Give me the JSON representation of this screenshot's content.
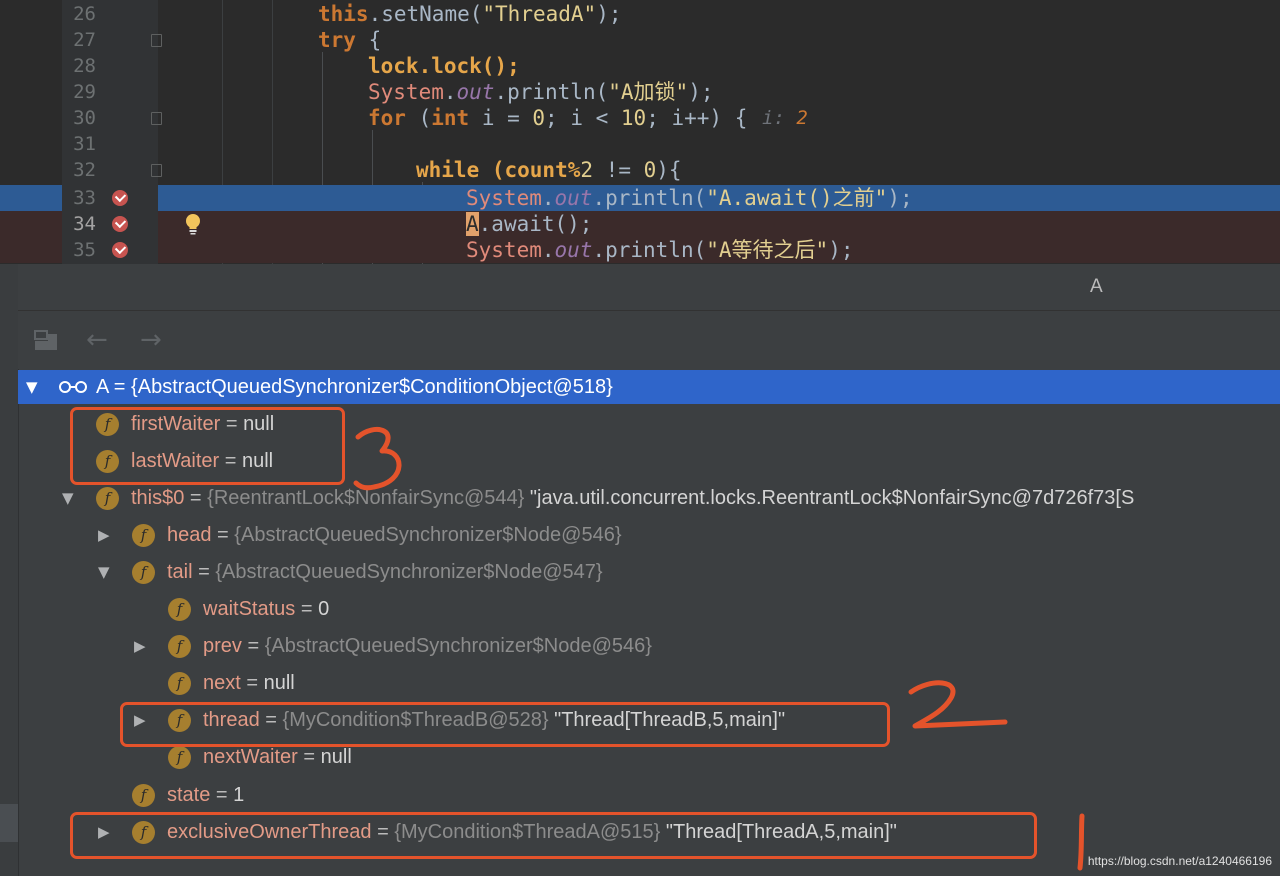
{
  "editor": {
    "lines": [
      {
        "num": "26",
        "parts": [
          [
            "kw",
            "this"
          ],
          [
            "p",
            "."
          ],
          [
            "p",
            "setName("
          ],
          [
            "str2",
            "\"ThreadA\""
          ],
          [
            "p",
            ");"
          ]
        ]
      },
      {
        "num": "27",
        "parts": [
          [
            "kw",
            "try"
          ],
          [
            "p",
            " {"
          ]
        ]
      },
      {
        "num": "28",
        "parts": [
          [
            "p",
            "lock.lock();"
          ]
        ]
      },
      {
        "num": "29",
        "parts": [
          [
            "cls",
            "System"
          ],
          [
            "p",
            "."
          ],
          [
            "fld",
            "out"
          ],
          [
            "p",
            ".println("
          ],
          [
            "str2",
            "\"A加锁\""
          ],
          [
            "p",
            ");"
          ]
        ]
      },
      {
        "num": "30",
        "parts": [
          [
            "kw",
            "for"
          ],
          [
            "p",
            " ("
          ],
          [
            "kw",
            "int"
          ],
          [
            "p",
            " i = "
          ],
          [
            "num",
            "0"
          ],
          [
            "p",
            "; i < "
          ],
          [
            "num",
            "10"
          ],
          [
            "p",
            "; i++) {"
          ]
        ]
      },
      {
        "num": "31",
        "parts": []
      },
      {
        "num": "32",
        "parts": [
          [
            "kw",
            "while"
          ],
          [
            "p",
            " (count%"
          ],
          [
            "num",
            "2"
          ],
          [
            "p",
            " != "
          ],
          [
            "num",
            "0"
          ],
          [
            "p",
            "){"
          ]
        ]
      },
      {
        "num": "33",
        "parts": [
          [
            "cls",
            "System"
          ],
          [
            "p",
            "."
          ],
          [
            "fld",
            "out"
          ],
          [
            "p",
            ".println("
          ],
          [
            "str2",
            "\"A.await()之前\""
          ],
          [
            "p",
            ");"
          ]
        ]
      },
      {
        "num": "34",
        "parts": [
          [
            "caret",
            "A"
          ],
          [
            "p",
            ".await();"
          ]
        ]
      },
      {
        "num": "35",
        "parts": [
          [
            "cls",
            "System"
          ],
          [
            "p",
            "."
          ],
          [
            "fld",
            "out"
          ],
          [
            "p",
            ".println("
          ],
          [
            "str2",
            "\"A等待之后\""
          ],
          [
            "p",
            ");"
          ]
        ]
      }
    ],
    "inline_hint": {
      "label": "i:",
      "value": "2"
    }
  },
  "debugger": {
    "tab_title": "A",
    "toolbar": {
      "back_icon": "arrow-left-icon",
      "forward_icon": "arrow-right-icon",
      "frames_icon": "frames-icon"
    },
    "tree": [
      {
        "id": "root",
        "name": "A",
        "eq": " = ",
        "type": "{AbstractQueuedSynchronizer$ConditionObject@518}",
        "value": ""
      },
      {
        "id": "firstWaiter",
        "name": "firstWaiter",
        "eq": " = ",
        "type": "",
        "value": "null"
      },
      {
        "id": "lastWaiter",
        "name": "lastWaiter",
        "eq": " = ",
        "type": "",
        "value": "null"
      },
      {
        "id": "this0",
        "name": "this$0",
        "eq": " = ",
        "type": "{ReentrantLock$NonfairSync@544}",
        "value": " \"java.util.concurrent.locks.ReentrantLock$NonfairSync@7d726f73[S"
      },
      {
        "id": "head",
        "name": "head",
        "eq": " = ",
        "type": "{AbstractQueuedSynchronizer$Node@546}",
        "value": ""
      },
      {
        "id": "tail",
        "name": "tail",
        "eq": " = ",
        "type": "{AbstractQueuedSynchronizer$Node@547}",
        "value": ""
      },
      {
        "id": "waitStatus",
        "name": "waitStatus",
        "eq": " = ",
        "type": "",
        "value": "0"
      },
      {
        "id": "prev",
        "name": "prev",
        "eq": " = ",
        "type": "{AbstractQueuedSynchronizer$Node@546}",
        "value": ""
      },
      {
        "id": "next",
        "name": "next",
        "eq": " = ",
        "type": "",
        "value": "null"
      },
      {
        "id": "thread",
        "name": "thread",
        "eq": " = ",
        "type": "{MyCondition$ThreadB@528}",
        "value": " \"Thread[ThreadB,5,main]\""
      },
      {
        "id": "nextWaiter",
        "name": "nextWaiter",
        "eq": " = ",
        "type": "",
        "value": "null"
      },
      {
        "id": "state",
        "name": "state",
        "eq": " = ",
        "type": "",
        "value": "1"
      },
      {
        "id": "exclusiveOwnerThread",
        "name": "exclusiveOwnerThread",
        "eq": " = ",
        "type": "{MyCondition$ThreadA@515}",
        "value": " \"Thread[ThreadA,5,main]\""
      }
    ]
  },
  "annotations": {
    "box_color": "#e4532b",
    "labels": [
      "3",
      "2",
      "1"
    ]
  },
  "watermark": "https://blog.csdn.net/a1240466196",
  "colors": {
    "selection": "#2f65ca",
    "field_icon": "#a67f2f",
    "breakpoint": "#c75450",
    "exec_line": "#2d5b94"
  }
}
